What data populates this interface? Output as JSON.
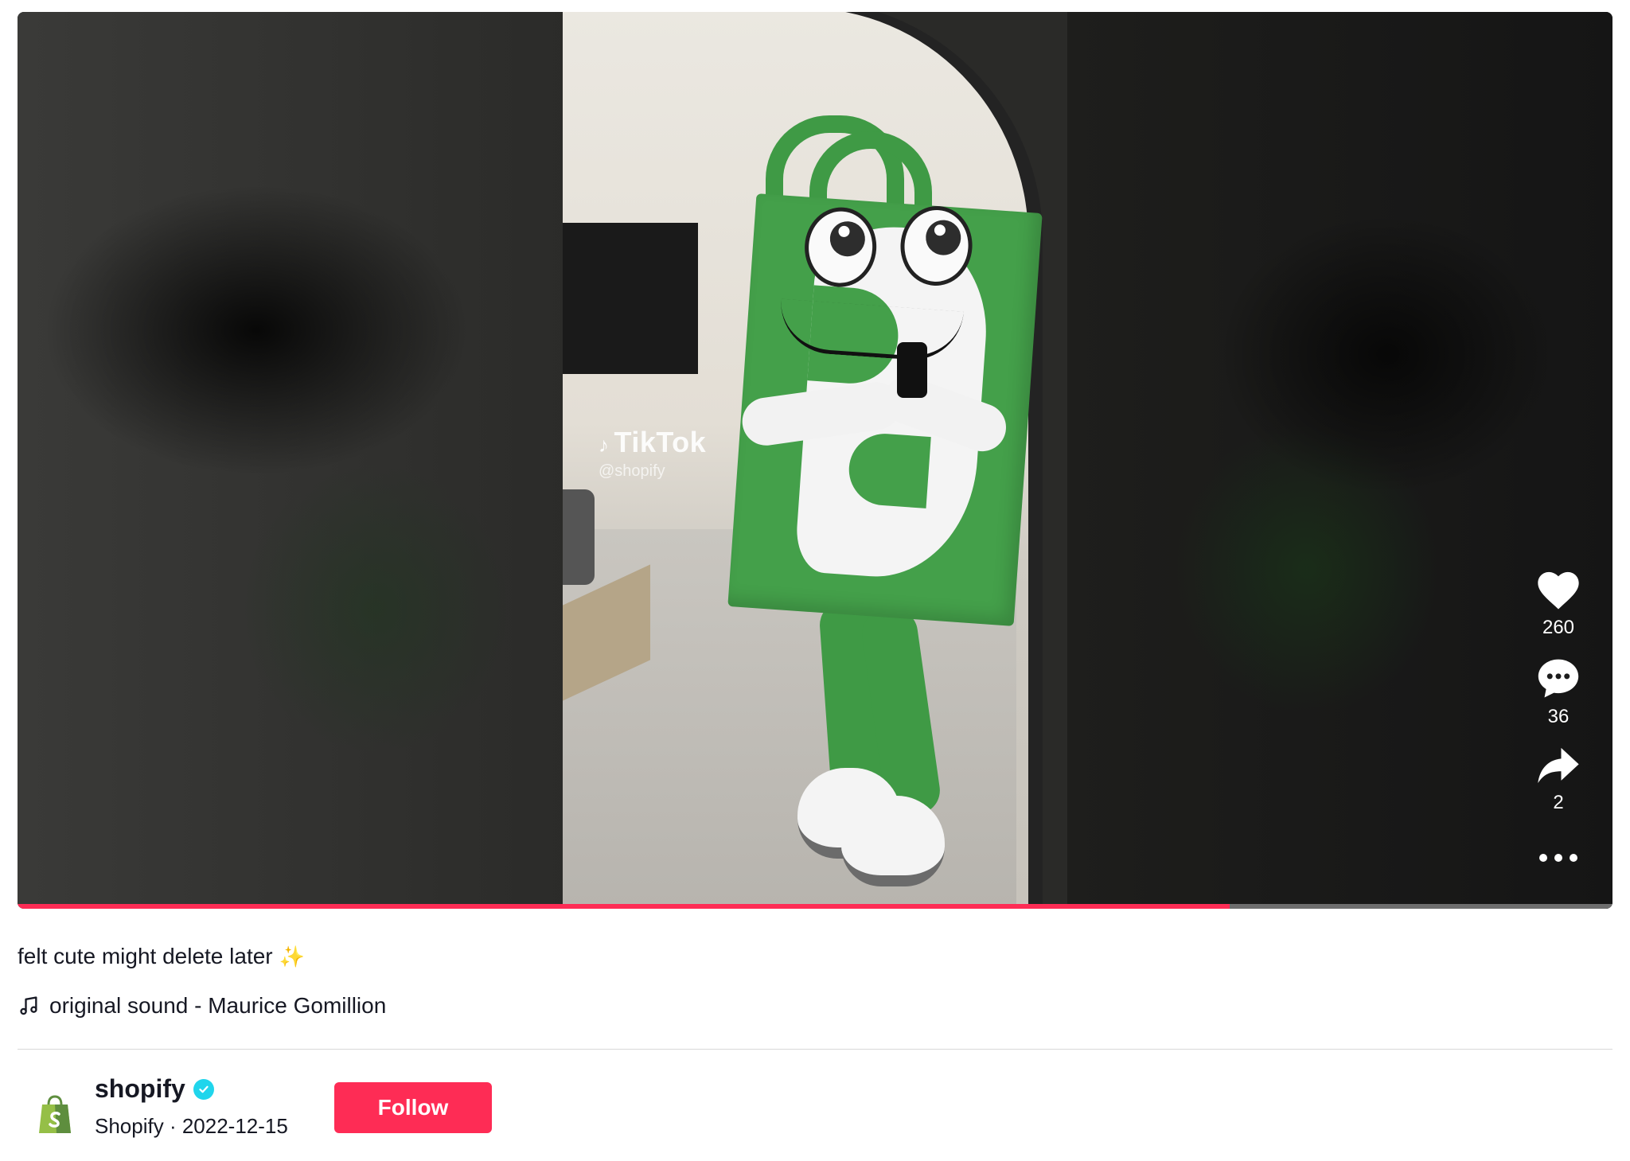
{
  "video": {
    "watermark_logo": "TikTok",
    "watermark_handle": "@shopify",
    "progress_fraction": 0.76,
    "progress_color": "#fe2c55"
  },
  "actions": {
    "like_count": "260",
    "comment_count": "36",
    "share_count": "2",
    "like_icon": "heart-icon",
    "comment_icon": "comment-bubble-icon",
    "share_icon": "share-arrow-icon",
    "more_icon": "more-dots-icon"
  },
  "post": {
    "caption": "felt cute might delete later",
    "caption_emoji": "✨",
    "sound": "original sound - Maurice Gomillion"
  },
  "author": {
    "username": "shopify",
    "verified_icon": "verified-check-icon",
    "display_name": "Shopify",
    "separator": " · ",
    "date": "2022-12-15",
    "follow_label": "Follow",
    "accent_color": "#fe2c55"
  }
}
